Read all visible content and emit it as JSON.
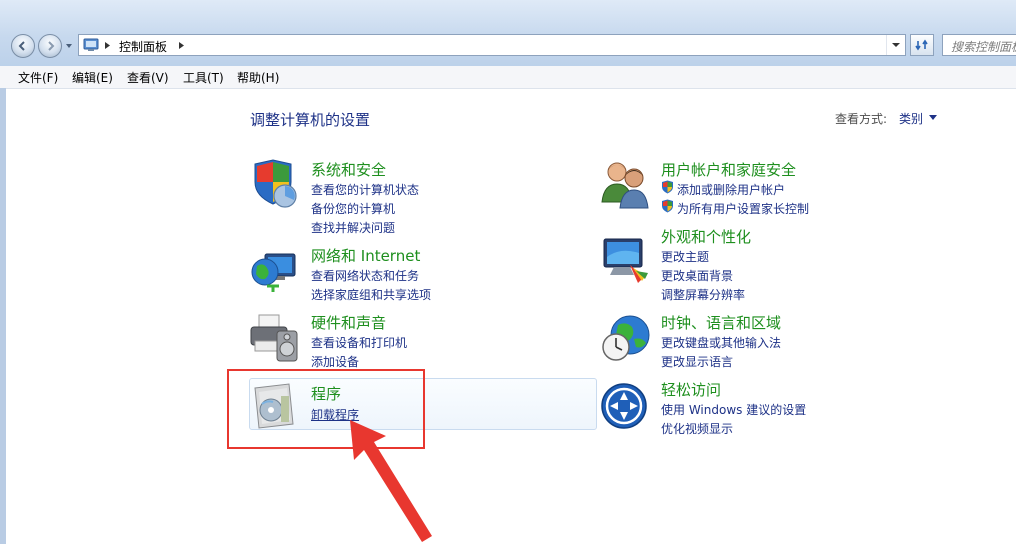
{
  "window": {
    "breadcrumb": "控制面板",
    "search_placeholder": "搜索控制面板"
  },
  "menu": [
    "文件(F)",
    "编辑(E)",
    "查看(V)",
    "工具(T)",
    "帮助(H)"
  ],
  "page": {
    "title": "调整计算机的设置",
    "view_by_label": "查看方式:",
    "view_by_value": "类别"
  },
  "categories": [
    {
      "title": "系统和安全",
      "icon": "shield-icon",
      "links": [
        "查看您的计算机状态",
        "备份您的计算机",
        "查找并解决问题"
      ]
    },
    {
      "title": "网络和 Internet",
      "icon": "network-globe-icon",
      "links": [
        "查看网络状态和任务",
        "选择家庭组和共享选项"
      ]
    },
    {
      "title": "硬件和声音",
      "icon": "printer-speaker-icon",
      "links": [
        "查看设备和打印机",
        "添加设备"
      ]
    },
    {
      "title": "程序",
      "icon": "programs-box-icon",
      "links": [
        "卸载程序"
      ]
    },
    {
      "title": "用户帐户和家庭安全",
      "icon": "users-icon",
      "links": [
        "添加或删除用户帐户",
        "为所有用户设置家长控制"
      ]
    },
    {
      "title": "外观和个性化",
      "icon": "monitor-paint-icon",
      "links": [
        "更改主题",
        "更改桌面背景",
        "调整屏幕分辨率"
      ]
    },
    {
      "title": "时钟、语言和区域",
      "icon": "globe-clock-icon",
      "links": [
        "更改键盘或其他输入法",
        "更改显示语言"
      ]
    },
    {
      "title": "轻松访问",
      "icon": "ease-of-access-icon",
      "links": [
        "使用 Windows 建议的设置",
        "优化视频显示"
      ]
    }
  ],
  "annotation": {
    "color": "#e8372f"
  }
}
